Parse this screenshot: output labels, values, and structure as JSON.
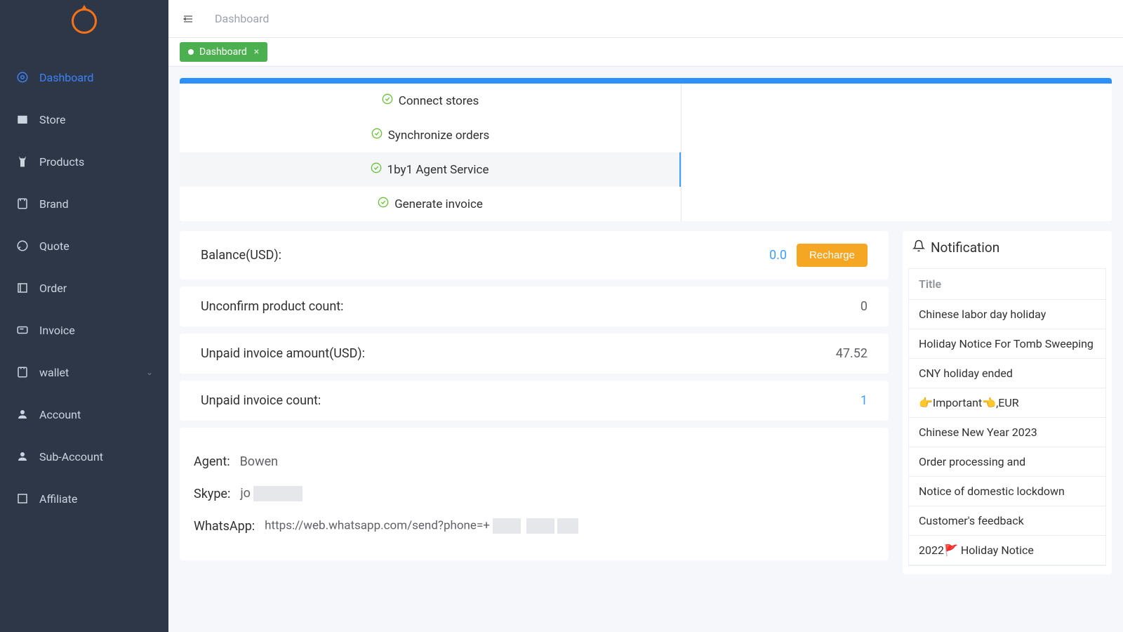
{
  "sidebar": {
    "items": [
      {
        "label": "Dashboard",
        "icon": "dashboard",
        "active": true
      },
      {
        "label": "Store",
        "icon": "store"
      },
      {
        "label": "Products",
        "icon": "products"
      },
      {
        "label": "Brand",
        "icon": "brand"
      },
      {
        "label": "Quote",
        "icon": "quote"
      },
      {
        "label": "Order",
        "icon": "order"
      },
      {
        "label": "Invoice",
        "icon": "invoice"
      },
      {
        "label": "wallet",
        "icon": "wallet",
        "expandable": true
      },
      {
        "label": "Account",
        "icon": "account"
      },
      {
        "label": "Sub-Account",
        "icon": "subaccount"
      },
      {
        "label": "Affiliate",
        "icon": "affiliate"
      }
    ]
  },
  "header": {
    "breadcrumb": "Dashboard"
  },
  "tabs": [
    {
      "label": "Dashboard",
      "active": true
    }
  ],
  "steps": [
    {
      "label": "Connect stores"
    },
    {
      "label": "Synchronize orders"
    },
    {
      "label": "1by1 Agent Service",
      "active": true
    },
    {
      "label": "Generate invoice"
    }
  ],
  "stats": {
    "balance_label": "Balance(USD):",
    "balance_value": "0.0",
    "recharge_label": "Recharge",
    "unconfirm_label": "Unconfirm product count:",
    "unconfirm_value": "0",
    "unpaid_amount_label": "Unpaid invoice amount(USD):",
    "unpaid_amount_value": "47.52",
    "unpaid_count_label": "Unpaid invoice count:",
    "unpaid_count_value": "1"
  },
  "agent": {
    "agent_label": "Agent:",
    "agent_value": "Bowen",
    "skype_label": "Skype:",
    "skype_value": "jo",
    "whatsapp_label": "WhatsApp:",
    "whatsapp_value": "https://web.whatsapp.com/send?phone=+"
  },
  "notifications": {
    "header": "Notification",
    "column": "Title",
    "items": [
      "Chinese labor day holiday",
      "Holiday Notice For Tomb Sweeping",
      "CNY holiday ended",
      "👉Important👈,EUR",
      "Chinese New Year 2023",
      "Order processing and",
      "Notice of domestic lockdown",
      "Customer's feedback",
      "2022🚩 Holiday Notice"
    ]
  }
}
